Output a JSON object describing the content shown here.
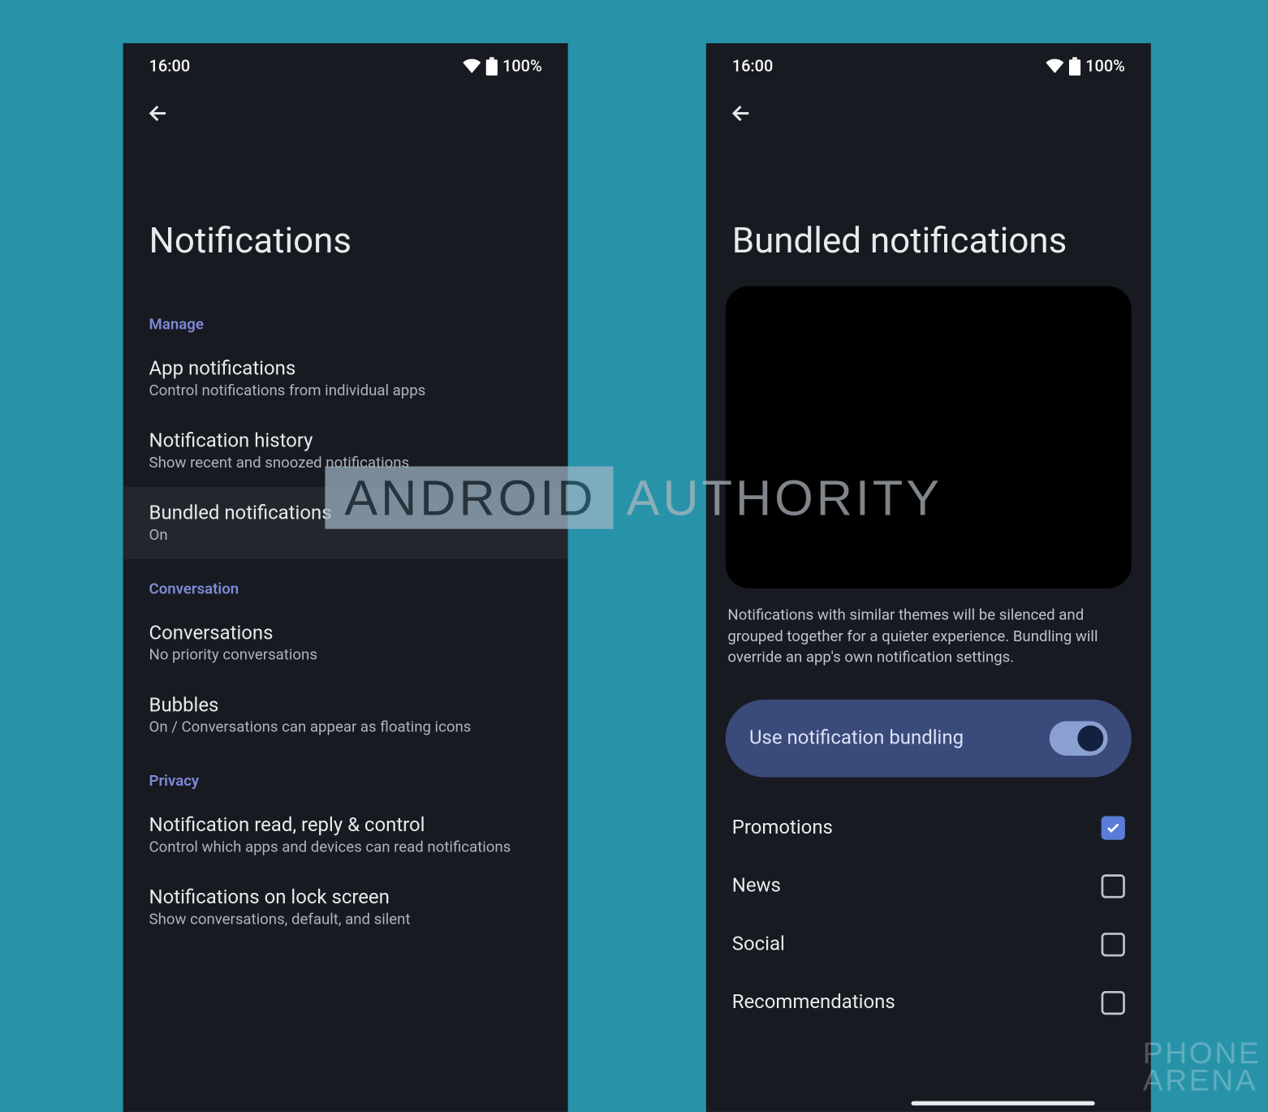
{
  "statusbar": {
    "time": "16:00",
    "battery": "100%"
  },
  "left": {
    "title": "Notifications",
    "sections": {
      "manage": {
        "header": "Manage",
        "app_notifications": {
          "title": "App notifications",
          "sub": "Control notifications from individual apps"
        },
        "history": {
          "title": "Notification history",
          "sub": "Show recent and snoozed notifications"
        },
        "bundled": {
          "title": "Bundled notifications",
          "sub": "On"
        }
      },
      "conversation": {
        "header": "Conversation",
        "conversations": {
          "title": "Conversations",
          "sub": "No priority conversations"
        },
        "bubbles": {
          "title": "Bubbles",
          "sub": "On / Conversations can appear as floating icons"
        }
      },
      "privacy": {
        "header": "Privacy",
        "read_reply": {
          "title": "Notification read, reply & control",
          "sub": "Control which apps and devices can read notifications"
        },
        "lockscreen": {
          "title": "Notifications on lock screen",
          "sub": "Show conversations, default, and silent"
        }
      }
    }
  },
  "right": {
    "title": "Bundled notifications",
    "description": "Notifications with similar themes will be silenced and grouped together for a quieter experience. Bundling will override an app's own notification settings.",
    "toggle_label": "Use notification bundling",
    "toggle_on": true,
    "categories": [
      {
        "label": "Promotions",
        "checked": true
      },
      {
        "label": "News",
        "checked": false
      },
      {
        "label": "Social",
        "checked": false
      },
      {
        "label": "Recommendations",
        "checked": false
      }
    ]
  },
  "watermark": {
    "center_box": "ANDROID",
    "center_text": "AUTHORITY",
    "corner_l1": "PHONE",
    "corner_l2": "ARENA"
  }
}
